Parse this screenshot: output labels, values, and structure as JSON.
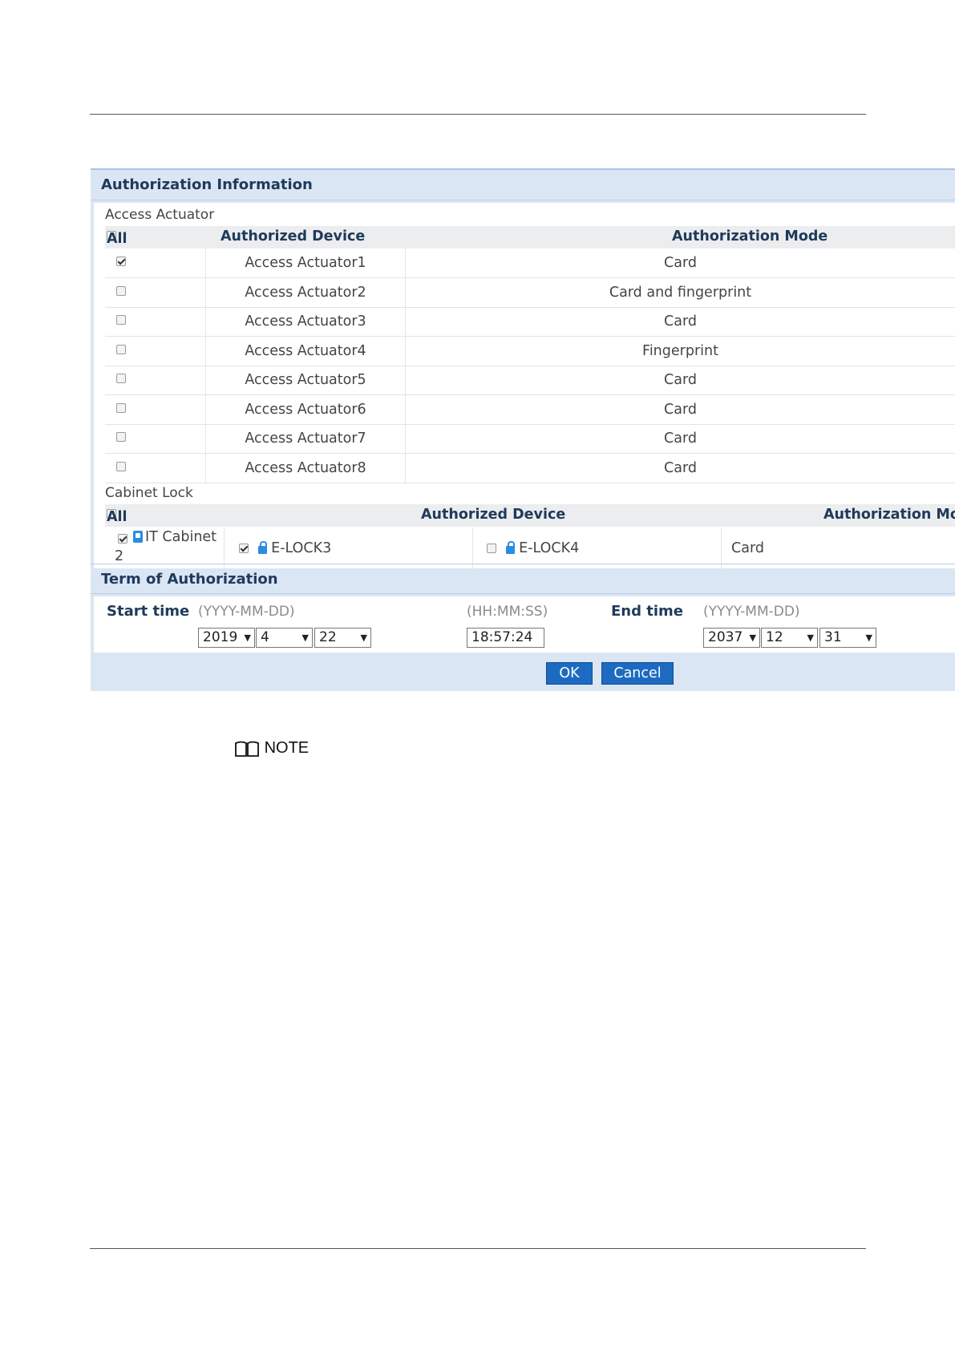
{
  "auth_info": {
    "title": "Authorization Information",
    "access_actuator": {
      "caption": "Access Actuator",
      "all_label": "All",
      "col_device": "Authorized Device",
      "col_mode": "Authorization Mode",
      "rows": [
        {
          "device": "Access Actuator1",
          "mode": "Card",
          "checked": true
        },
        {
          "device": "Access Actuator2",
          "mode": "Card and fingerprint",
          "checked": false
        },
        {
          "device": "Access Actuator3",
          "mode": "Card",
          "checked": false
        },
        {
          "device": "Access Actuator4",
          "mode": "Fingerprint",
          "checked": false
        },
        {
          "device": "Access Actuator5",
          "mode": "Card",
          "checked": false
        },
        {
          "device": "Access Actuator6",
          "mode": "Card",
          "checked": false
        },
        {
          "device": "Access Actuator7",
          "mode": "Card",
          "checked": false
        },
        {
          "device": "Access Actuator8",
          "mode": "Card",
          "checked": false
        }
      ]
    },
    "cabinet_lock": {
      "caption": "Cabinet Lock",
      "all_label": "All",
      "col_device": "Authorized Device",
      "col_mode": "Authorization Mo",
      "cabinet_name_line1": "IT Cabinet",
      "cabinet_name_line2": "2",
      "lock1": "E-LOCK3",
      "lock2": "E-LOCK4",
      "mode": "Card"
    }
  },
  "term": {
    "title": "Term of Authorization",
    "start_label": "Start time",
    "end_label": "End time",
    "date_hint": "(YYYY-MM-DD)",
    "time_hint": "(HH:MM:SS)",
    "start_year": "2019",
    "start_month": "4",
    "start_day": "22",
    "start_time": "18:57:24",
    "end_year": "2037",
    "end_month": "12",
    "end_day": "31"
  },
  "buttons": {
    "ok": "OK",
    "cancel": "Cancel"
  },
  "note_label": "NOTE"
}
